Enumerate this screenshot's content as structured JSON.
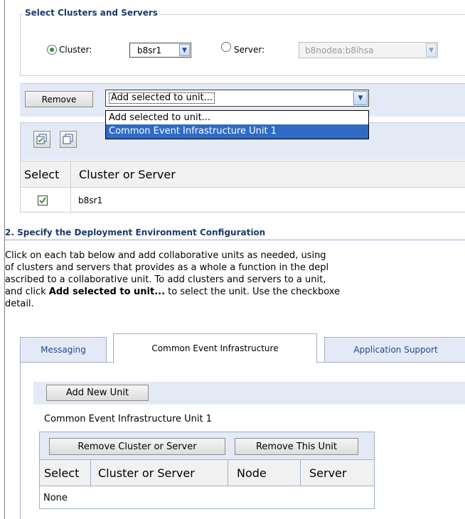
{
  "cluster_section": {
    "title": "Select Clusters and Servers",
    "cluster_label": "Cluster:",
    "cluster_value": "b8sr1",
    "server_label": "Server:",
    "server_value": "b8nodea:b8ihsa"
  },
  "toolbar": {
    "remove_label": "Remove",
    "unit_select_value": "Add selected to unit...",
    "dropdown_options": [
      "Add selected to unit...",
      "Common Event Infrastructure Unit 1"
    ]
  },
  "selection_table": {
    "headers": [
      "Select",
      "Cluster or Server"
    ],
    "rows": [
      {
        "checked": true,
        "name": "b8sr1"
      }
    ]
  },
  "section2": {
    "title": "2. Specify the Deployment Environment Configuration",
    "desc_line1": "Click on each tab below and add collaborative units as needed, using",
    "desc_line2": "of clusters and servers that provides as a whole a function in the depl",
    "desc_line3": "ascribed to a collaborative unit. To add clusters and servers to a unit,",
    "desc_line4_pre": "and click ",
    "desc_line4_bold": "Add selected to unit...",
    "desc_line4_post": " to select the unit. Use the checkboxe",
    "desc_line5": "detail."
  },
  "tabs": [
    "Messaging",
    "Common Event Infrastructure",
    "Application Support"
  ],
  "unit_panel": {
    "add_new_unit": "Add New Unit",
    "unit_name": "Common Event Infrastructure Unit 1",
    "remove_cluster_or_server": "Remove Cluster or Server",
    "remove_this_unit": "Remove This Unit",
    "headers": [
      "Select",
      "Cluster or Server",
      "Node",
      "Server"
    ],
    "empty_text": "None"
  },
  "colors": {
    "accent": "#1c3b6b",
    "selection": "#316ac5",
    "border": "#9fb0c8"
  }
}
